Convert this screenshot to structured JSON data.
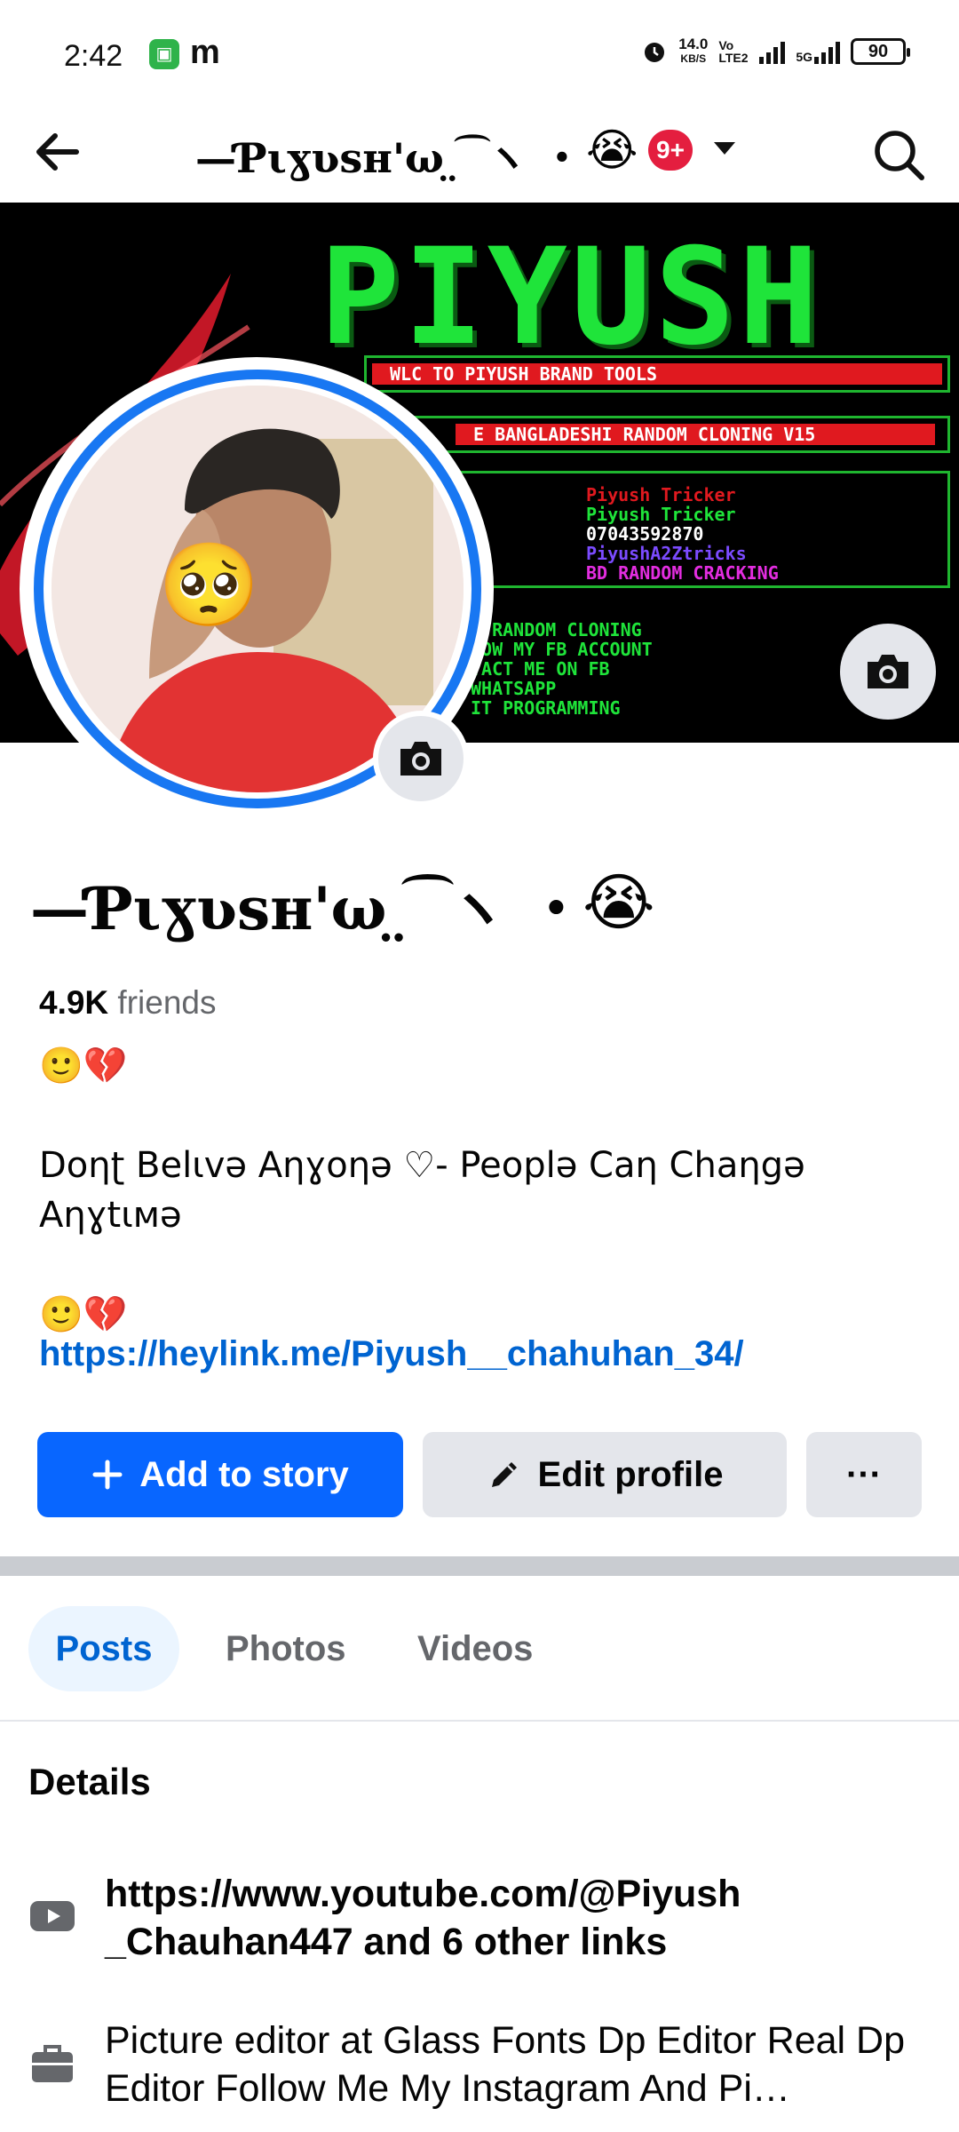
{
  "status_bar": {
    "time": "2:42",
    "app_letter": "m",
    "speed_value": "14.0",
    "speed_unit": "KB/S",
    "lte": "Vo LTE2",
    "net": "5G",
    "battery": "90"
  },
  "nav": {
    "title": "—Ƥιɣʋsʜ'ω ̤ ͡ ヽ ・",
    "emoji": "😭",
    "badge": "9+"
  },
  "cover": {
    "brand": "PIYUSH",
    "line1": "WLC TO  PIYUSH BRAND TOOLS",
    "line2": "E BANGLADESHI RANDOM CLONING V15",
    "info": [
      "Piyush Tricker",
      "Piyush Tricker",
      "07043592870",
      "PiyushA2Ztricks",
      "BD RANDOM CRACKING"
    ],
    "menu": [
      "T RANDOM CLONING",
      "LOW MY FB ACCOUNT",
      "TACT ME ON FB",
      "WHATSAPP",
      "IT PROGRAMMING"
    ]
  },
  "profile": {
    "name": "—Ƥιɣʋsʜ'ω ̤ ͡ ヽ ・",
    "name_emoji": "😭",
    "friends_count": "4.9K",
    "friends_label": " friends",
    "bio": "🙂💔\n\nDoƞʈ Belιvə Aƞɣoƞə ♡- Peoplə Caƞ Chaƞgə Aƞɣtιмə\n\n🙂💔",
    "link": "https://heylink.me/Piyush__chahuhan_34/"
  },
  "actions": {
    "add_story": "Add to story",
    "edit_profile": "Edit profile",
    "more": "···"
  },
  "tabs": [
    "Posts",
    "Photos",
    "Videos"
  ],
  "details": {
    "heading": "Details",
    "items": [
      {
        "icon": "youtube-icon",
        "text": "https://www.youtube.com/@Piyush _Chauhan447 and 6 other links"
      },
      {
        "icon": "briefcase-icon",
        "text": "Picture editor at Glass Fonts Dp Editor Real Dp Editor Follow Me My Instagram And Pi…"
      }
    ]
  },
  "colors": {
    "accent": "#0866ff",
    "link": "#0064d1",
    "badge": "#e41e3f",
    "cover_green": "#1fe43a"
  }
}
